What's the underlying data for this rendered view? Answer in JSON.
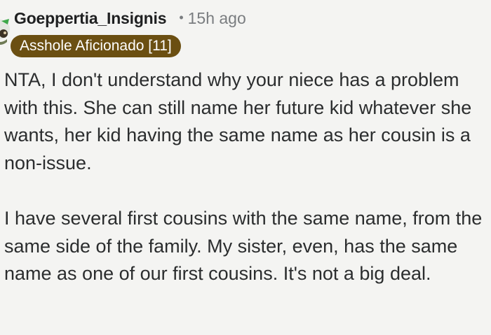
{
  "comment": {
    "username": "Goeppertia_Insignis",
    "separator": "•",
    "timestamp": "15h ago",
    "flair": "Asshole Aficionado [11]",
    "paragraphs": [
      "NTA, I don't understand why your niece has a problem with this. She can still name her future kid whatever she wants, her kid having the same name as her cousin is a non-issue.",
      "I have several first cousins with the same name, from the same side of the family. My sister, even, has the same name as one of our first cousins. It's not a big deal."
    ]
  },
  "colors": {
    "background": "#f4f4f2",
    "flair_background": "#6b4f12",
    "flair_text": "#ffffff",
    "meta_text": "#7a7d80",
    "body_text": "#2b2d2e"
  },
  "icons": {
    "avatar": "user-avatar-icon"
  }
}
